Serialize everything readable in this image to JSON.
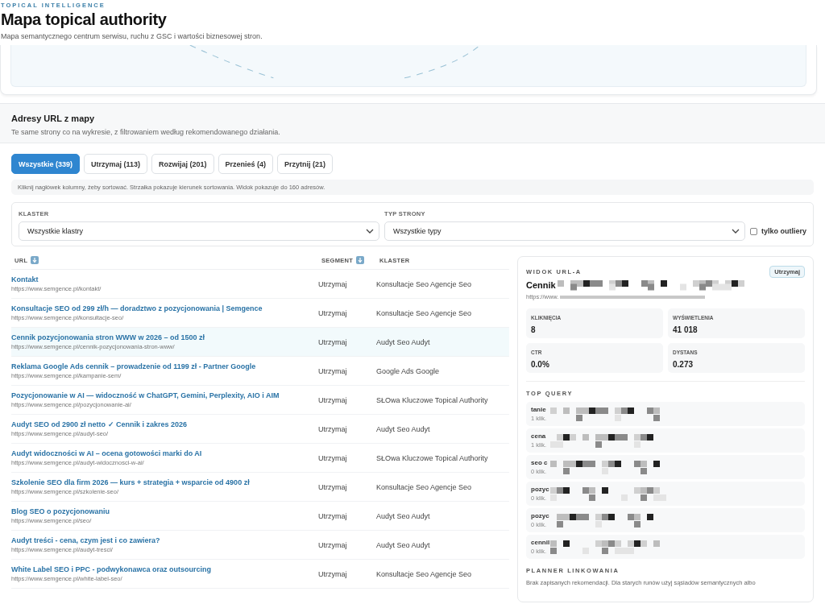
{
  "header": {
    "eyebrow": "TOPICAL INTELLIGENCE",
    "title": "Mapa topical authority",
    "subtitle": "Mapa semantycznego centrum serwisu, ruchu z GSC i wartości biznesowej stron."
  },
  "section": {
    "title": "Adresy URL z mapy",
    "subtitle": "Te same strony co na wykresie, z filtrowaniem według rekomendowanego działania."
  },
  "tabs": [
    {
      "label": "Wszystkie (339)",
      "selected": true
    },
    {
      "label": "Utrzymaj (113)",
      "selected": false
    },
    {
      "label": "Rozwijaj (201)",
      "selected": false
    },
    {
      "label": "Przenieś (4)",
      "selected": false
    },
    {
      "label": "Przytnij (21)",
      "selected": false
    }
  ],
  "hint": "Kliknij nagłówek kolumny, żeby sortować. Strzałka pokazuje kierunek sortowania. Widok pokazuje do 160 adresów.",
  "filters": {
    "cluster": {
      "label": "KLASTER",
      "value": "Wszystkie klastry"
    },
    "type": {
      "label": "TYP STRONY",
      "value": "Wszystkie typy"
    },
    "outliers": {
      "label": "tylko outliery",
      "checked": false
    }
  },
  "table": {
    "columns": [
      {
        "label": "URL",
        "sortable": true
      },
      {
        "label": "SEGMENT",
        "sortable": true
      },
      {
        "label": "KLASTER",
        "sortable": false
      }
    ],
    "rows": [
      {
        "title": "Kontakt",
        "url": "https://www.semgence.pl/kontakt/",
        "segment": "Utrzymaj",
        "cluster": "Konsultacje Seo Agencje Seo",
        "selected": false
      },
      {
        "title": "Konsultacje SEO od 299 zł/h — doradztwo z pozycjonowania | Semgence",
        "url": "https://www.semgence.pl/konsultacje-seo/",
        "segment": "Utrzymaj",
        "cluster": "Konsultacje Seo Agencje Seo",
        "selected": false
      },
      {
        "title": "Cennik pozycjonowania stron WWW w 2026 – od 1500 zł",
        "url": "https://www.semgence.pl/cennik-pozycjonowania-stron-www/",
        "segment": "Utrzymaj",
        "cluster": "Audyt Seo Audyt",
        "selected": true
      },
      {
        "title": "Reklama Google Ads cennik – prowadzenie od 1199 zł - Partner Google",
        "url": "https://www.semgence.pl/kampanie-sem/",
        "segment": "Utrzymaj",
        "cluster": "Google Ads Google",
        "selected": false
      },
      {
        "title": "Pozycjonowanie w AI — widoczność w ChatGPT, Gemini, Perplexity, AIO i AIM",
        "url": "https://www.semgence.pl/pozycjonowanie-ai/",
        "segment": "Utrzymaj",
        "cluster": "SŁOwa Kluczowe Topical Authority",
        "selected": false
      },
      {
        "title": "Audyt SEO od 2900 zł netto ✓ Cennik i zakres 2026",
        "url": "https://www.semgence.pl/audyt-seo/",
        "segment": "Utrzymaj",
        "cluster": "Audyt Seo Audyt",
        "selected": false
      },
      {
        "title": "Audyt widoczności w AI – ocena gotowości marki do AI",
        "url": "https://www.semgence.pl/audyt-widocznosci-w-ai/",
        "segment": "Utrzymaj",
        "cluster": "SŁOwa Kluczowe Topical Authority",
        "selected": false
      },
      {
        "title": "Szkolenie SEO dla firm 2026 — kurs + strategia + wsparcie od 4900 zł",
        "url": "https://www.semgence.pl/szkolenie-seo/",
        "segment": "Utrzymaj",
        "cluster": "Konsultacje Seo Agencje Seo",
        "selected": false
      },
      {
        "title": "Blog SEO o pozycjonowaniu",
        "url": "https://www.semgence.pl/seo/",
        "segment": "Utrzymaj",
        "cluster": "Audyt Seo Audyt",
        "selected": false
      },
      {
        "title": "Audyt treści - cena, czym jest i co zawiera?",
        "url": "https://www.semgence.pl/audyt-tresci/",
        "segment": "Utrzymaj",
        "cluster": "Audyt Seo Audyt",
        "selected": false
      },
      {
        "title": "White Label SEO i PPC - podwykonawca oraz outsourcing",
        "url": "https://www.semgence.pl/white-label-seo/",
        "segment": "Utrzymaj",
        "cluster": "Konsultacje Seo Agencje Seo",
        "selected": false
      }
    ]
  },
  "detail": {
    "label": "WIDOK URL-A",
    "badge": "Utrzymaj",
    "title": "Cennik",
    "url": "https://www.",
    "stats": [
      {
        "label": "KLIKNIĘCIA",
        "value": "8"
      },
      {
        "label": "WYŚWIETLENIA",
        "value": "41 018"
      },
      {
        "label": "CTR",
        "value": "0.0%"
      },
      {
        "label": "DYSTANS",
        "value": "0.273"
      }
    ],
    "top_query_label": "TOP QUERY",
    "queries": [
      {
        "query": "tanie",
        "clicks": "1 klik."
      },
      {
        "query": "cena",
        "clicks": "1 klik."
      },
      {
        "query": "seo c",
        "clicks": "0 klik."
      },
      {
        "query": "pozyc",
        "clicks": "0 klik."
      },
      {
        "query": "pozyc",
        "clicks": "0 klik."
      },
      {
        "query": "cennil",
        "clicks": "0 klik."
      }
    ],
    "planner_label": "PLANNER LINKOWANIA",
    "planner_text": "Brak zapisanych rekomendacji. Dla starych runów użyj sąsiadów semantycznych albo"
  }
}
